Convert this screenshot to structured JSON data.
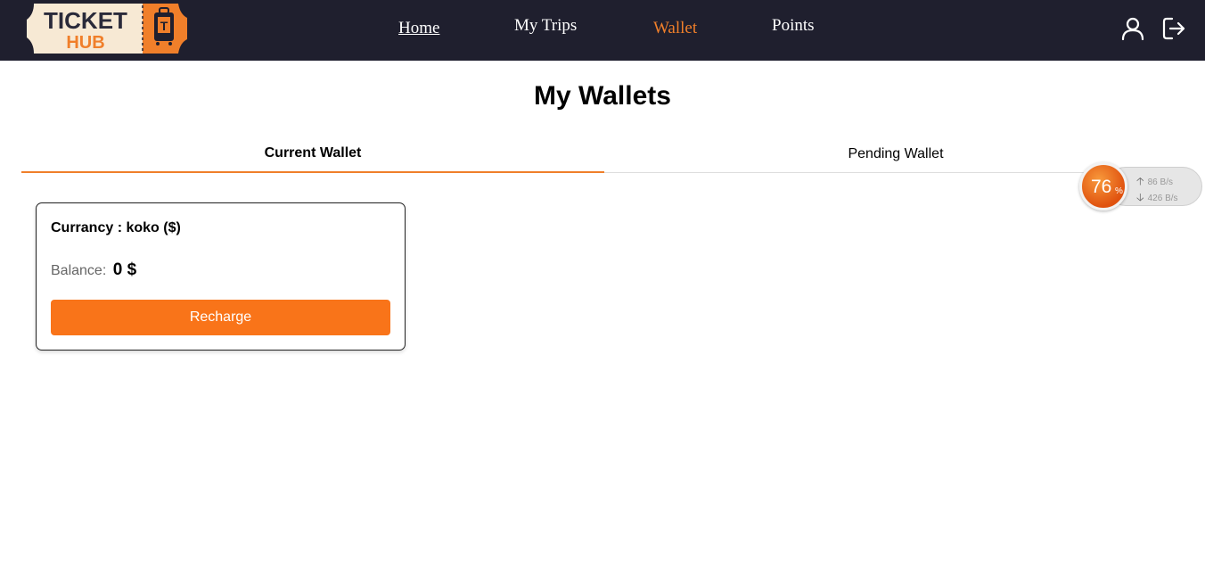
{
  "brand": {
    "logo_word1": "TICKET",
    "logo_word2": "HUB",
    "logo_badge": "T"
  },
  "nav": {
    "home": "Home",
    "trips": "My Trips",
    "wallet": "Wallet",
    "points": "Points",
    "active": "Wallet",
    "icons": [
      "user-icon",
      "logout-icon"
    ]
  },
  "page": {
    "title": "My Wallets"
  },
  "tabs": [
    {
      "label": "Current Wallet",
      "active": true
    },
    {
      "label": "Pending Wallet",
      "active": false
    }
  ],
  "wallet": {
    "currency": "Currancy : koko ($)",
    "balance_label": "Balance:",
    "balance_value": "0 $",
    "recharge_label": "Recharge"
  },
  "net_widget": {
    "percent": "76",
    "percent_sign": "%",
    "upload": "86 B/s",
    "download": "426 B/s"
  },
  "colors": {
    "navbar": "#1f1f2e",
    "accent": "#f07f2a",
    "button": "#f97419"
  }
}
